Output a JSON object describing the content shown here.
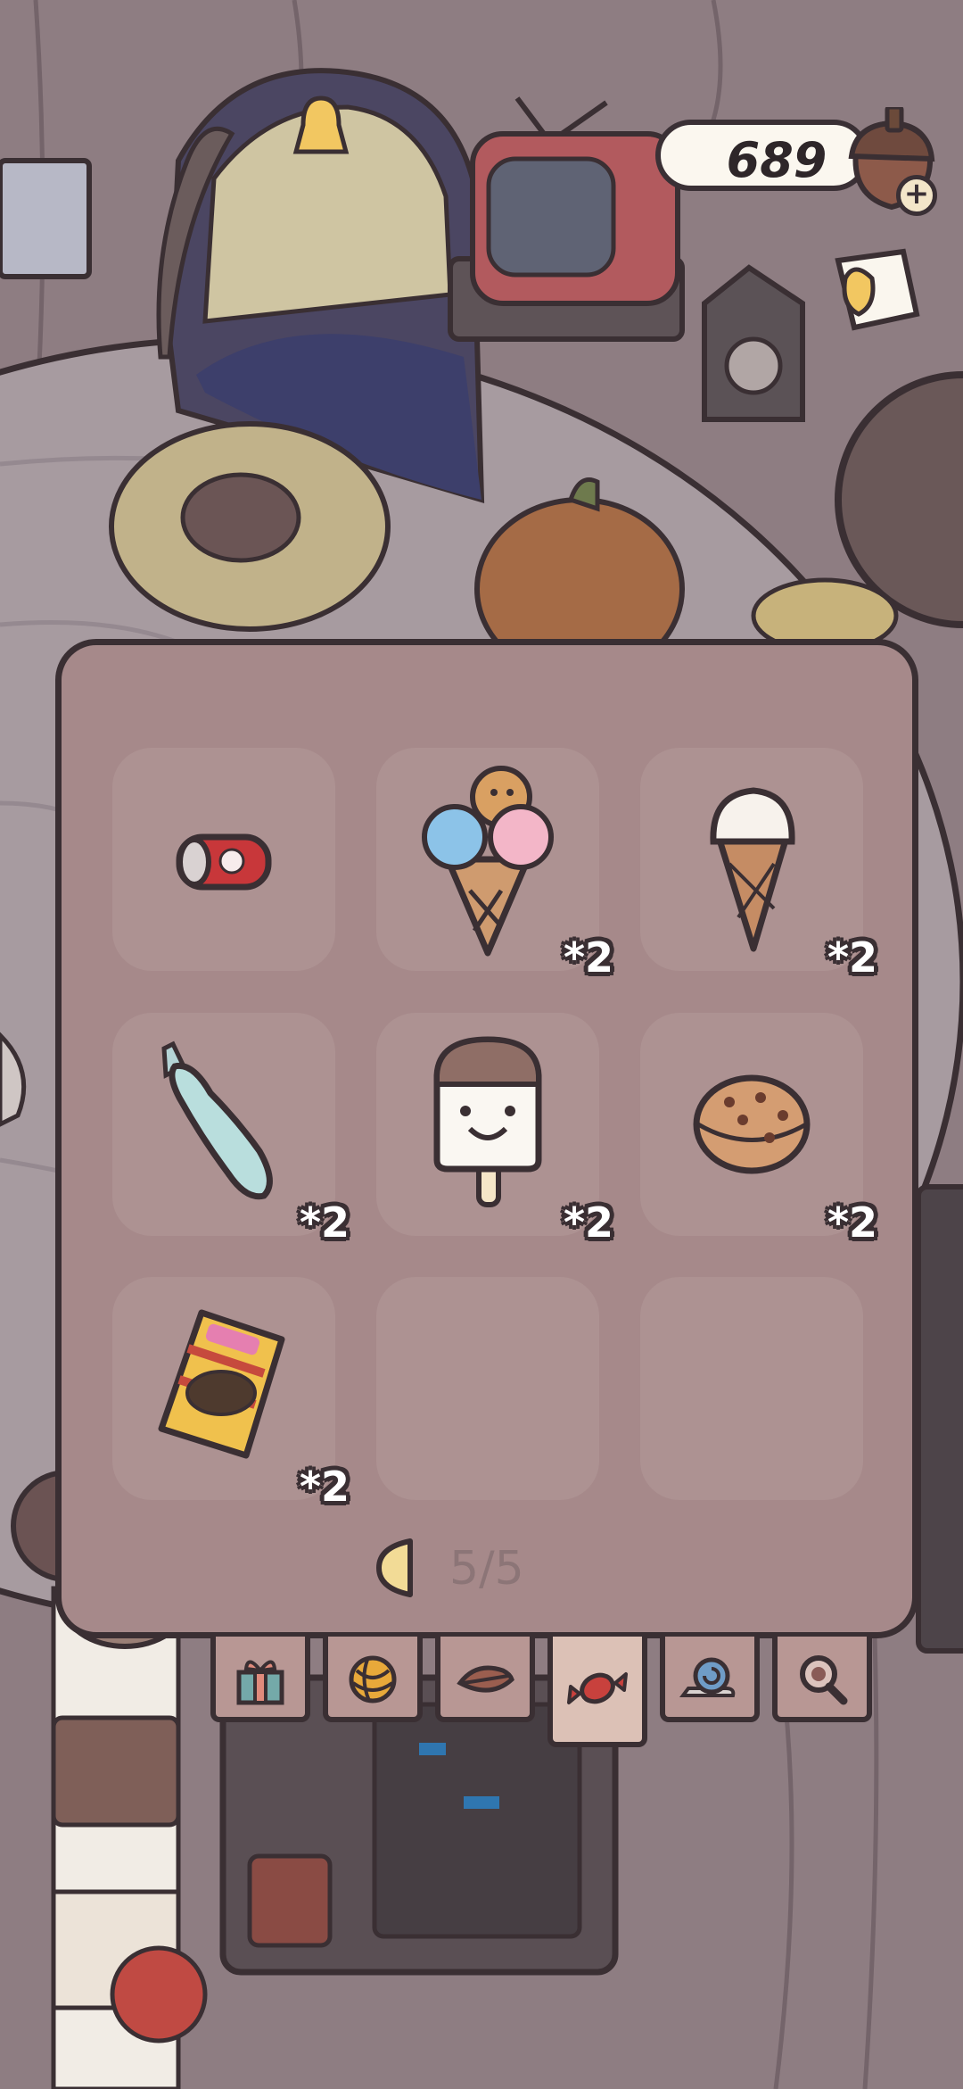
{
  "currency": {
    "value": "689",
    "icon": "acorn-icon",
    "add_icon": "plus-icon"
  },
  "top_right_tool": "paper-tool-icon",
  "inventory": {
    "items": [
      {
        "name": "soda-can-icon",
        "count": ""
      },
      {
        "name": "triple-scoop-animal-ice-cream-icon",
        "count": "*2"
      },
      {
        "name": "vanilla-ice-cream-cone-icon",
        "count": "*2"
      },
      {
        "name": "ice-candy-stick-icon",
        "count": "*2"
      },
      {
        "name": "smiling-popsicle-icon",
        "count": "*2"
      },
      {
        "name": "cookie-icon",
        "count": "*2"
      },
      {
        "name": "snack-bag-icon",
        "count": "*2"
      },
      {
        "name": "empty",
        "count": ""
      },
      {
        "name": "empty",
        "count": ""
      }
    ],
    "page": "5/5"
  },
  "tabs": [
    {
      "name": "gift-icon",
      "active": false
    },
    {
      "name": "yarn-icon",
      "active": false
    },
    {
      "name": "leaf-icon",
      "active": false
    },
    {
      "name": "candy-icon",
      "active": true
    },
    {
      "name": "snail-icon",
      "active": false
    },
    {
      "name": "magnifier-icon",
      "active": false
    }
  ],
  "colors": {
    "panel": "#a6898a",
    "outline": "#3a2f33",
    "active_tab": "#dcc1b6"
  }
}
